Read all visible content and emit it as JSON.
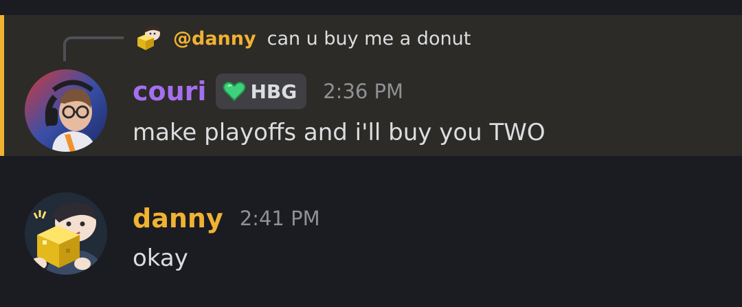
{
  "reply": {
    "mention": "@danny",
    "text": "can u buy me a donut"
  },
  "messages": [
    {
      "username": "couri",
      "username_color": "#a46ff0",
      "badge": {
        "icon": "green-heart-icon",
        "label": "HBG"
      },
      "timestamp": "2:36 PM",
      "text": "make playoffs and i'll buy you TWO"
    },
    {
      "username": "danny",
      "username_color": "#f0b232",
      "timestamp": "2:41 PM",
      "text": "okay"
    }
  ],
  "colors": {
    "background": "#1b1c21",
    "highlight": "#2d2b27",
    "highlight_bar": "#f0b232",
    "text": "#dbdee1",
    "timestamp": "#8e9196"
  }
}
